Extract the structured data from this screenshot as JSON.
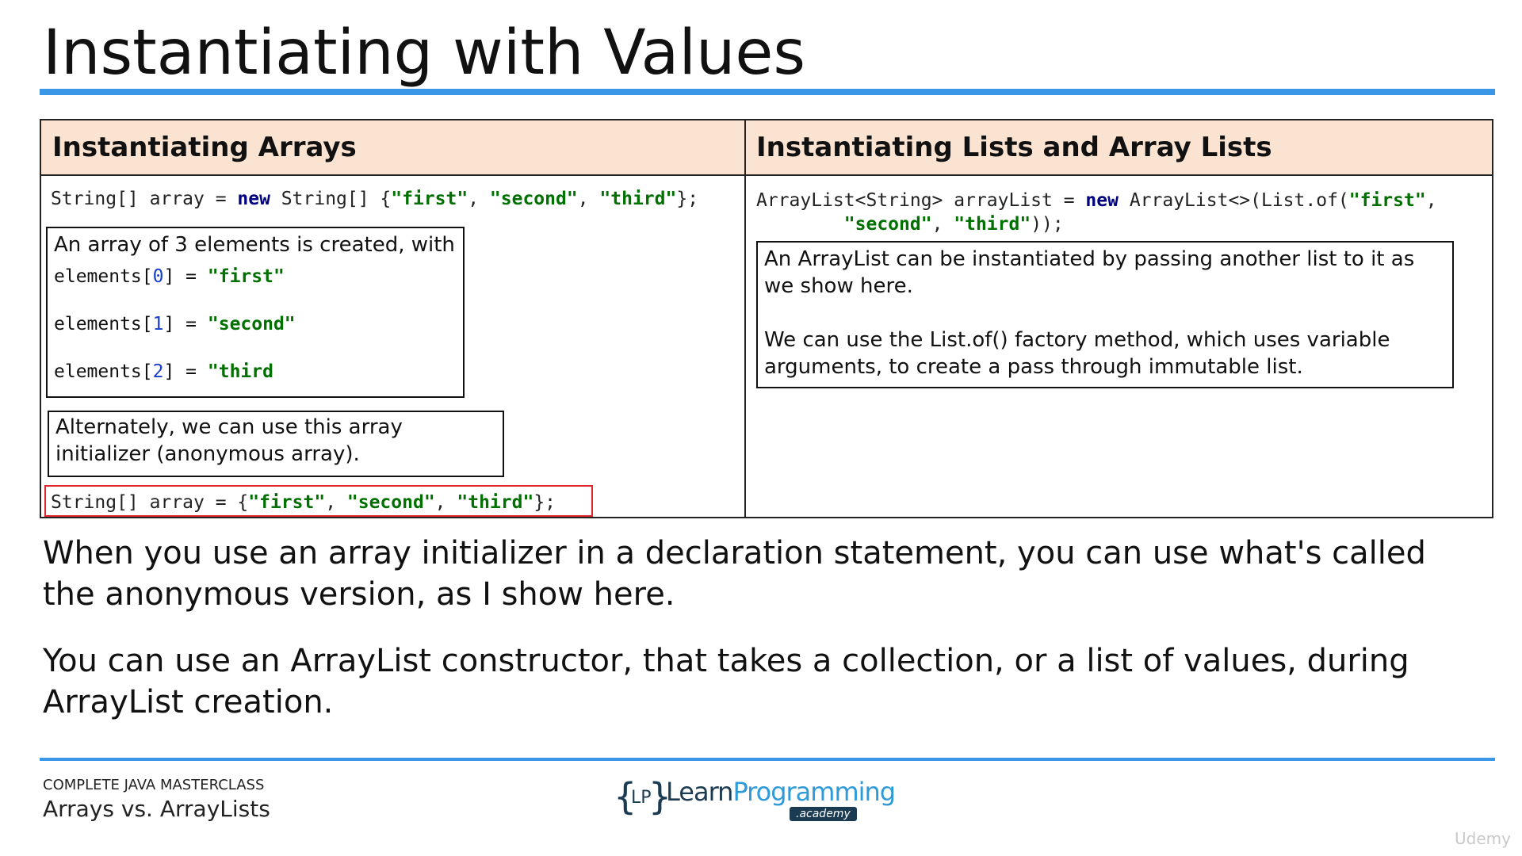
{
  "slide": {
    "title": "Instantiating with Values"
  },
  "table": {
    "left_header": "Instantiating Arrays",
    "right_header": "Instantiating Lists and Array Lists"
  },
  "left": {
    "code1": {
      "t1": "String[] array = ",
      "kw": "new",
      "t2": " String[] {",
      "s1": "\"first\"",
      "c1": ", ",
      "s2": "\"second\"",
      "c2": ", ",
      "s3": "\"third\"",
      "t3": "};"
    },
    "note1": {
      "intro": "An array of 3 elements is created, with",
      "elements": [
        {
          "pre": "elements[",
          "idx": "0",
          "post": "] = ",
          "val": "\"first\""
        },
        {
          "pre": "elements[",
          "idx": "1",
          "post": "] = ",
          "val": "\"second\""
        },
        {
          "pre": "elements[",
          "idx": "2",
          "post": "] = ",
          "val": "\"third"
        }
      ]
    },
    "note2": "Alternately, we can use this array initializer (anonymous array).",
    "code2": {
      "t1": "String[] array = {",
      "s1": "\"first\"",
      "c1": ", ",
      "s2": "\"second\"",
      "c2": ", ",
      "s3": "\"third\"",
      "t2": "};"
    }
  },
  "right": {
    "code": {
      "t1": "ArrayList<String> arrayList = ",
      "kw": "new",
      "t2": " ArrayList<>(List.of(",
      "s1": "\"first\"",
      "c1": ",",
      "indent": "        ",
      "s2": "\"second\"",
      "c2": ", ",
      "s3": "\"third\"",
      "t3": "));"
    },
    "note": {
      "p1": "An ArrayList can be instantiated by passing another list to it as we show here.",
      "p2": "We can use the List.of() factory method, which uses variable arguments, to create a pass through immutable list."
    }
  },
  "body": {
    "para1": "When you use an array initializer in a declaration statement, you can use what's called the anonymous version, as I show here.",
    "para2": "You can use an ArrayList constructor, that takes a collection, or a list of values, during ArrayList creation."
  },
  "footer": {
    "course": "COMPLETE JAVA MASTERCLASS",
    "lesson": "Arrays vs. ArrayLists",
    "logo": {
      "braces": "{ }",
      "lp": "LP",
      "learn": "Learn",
      "programming": "Programming",
      "academy": ".academy"
    },
    "watermark": "Udemy"
  },
  "colors": {
    "accent_rule": "#3a96e6",
    "header_fill": "#fbe3d1",
    "keyword": "#000080",
    "string": "#007000",
    "number": "#1a3ec8",
    "highlight_border": "#e0262a"
  }
}
